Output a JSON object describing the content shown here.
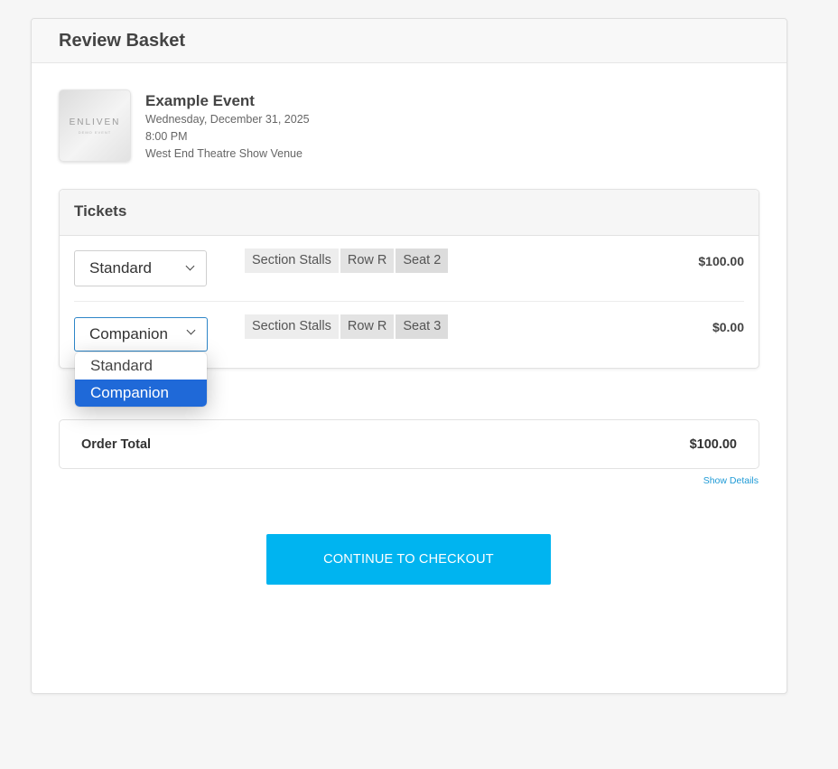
{
  "header": {
    "title": "Review Basket"
  },
  "event": {
    "logo_text": "ENLIVEN",
    "logo_subtext": "DEMO EVENT",
    "name": "Example Event",
    "date": "Wednesday, December 31, 2025",
    "time": "8:00 PM",
    "venue": "West End Theatre Show Venue"
  },
  "tickets": {
    "title": "Tickets",
    "rows": [
      {
        "type": "Standard",
        "section": "Section Stalls",
        "row": "Row R",
        "seat": "Seat 2",
        "price": "$100.00"
      },
      {
        "type": "Companion",
        "section": "Section Stalls",
        "row": "Row R",
        "seat": "Seat 3",
        "price": "$0.00"
      }
    ],
    "dropdown_options": [
      "Standard",
      "Companion"
    ],
    "dropdown_selected": "Companion"
  },
  "order": {
    "total_label": "Order Total",
    "total_value": "$100.00",
    "show_details": "Show Details"
  },
  "checkout": {
    "label": "CONTINUE TO CHECKOUT"
  },
  "colors": {
    "accent": "#00b4f0",
    "link": "#1e9ad6",
    "dropdown_highlight": "#1f69d8",
    "focus_border": "#2e86c8"
  }
}
